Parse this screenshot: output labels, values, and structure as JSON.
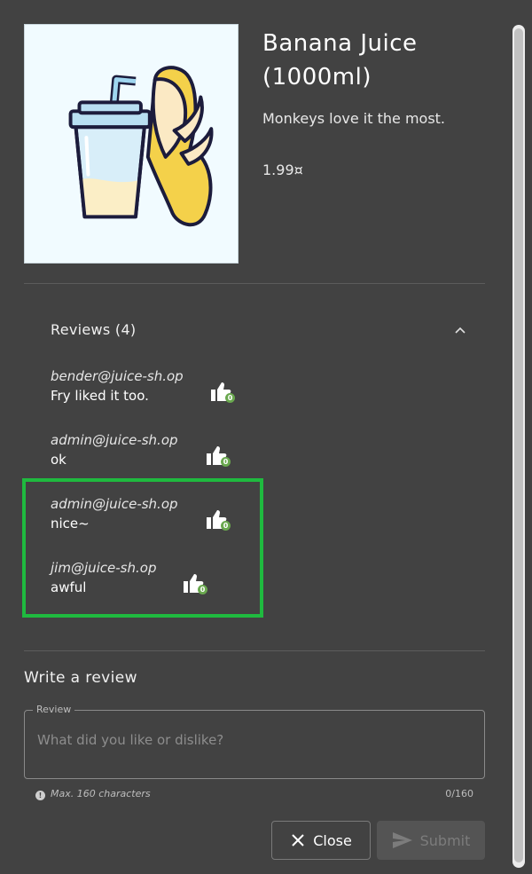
{
  "product": {
    "name": "Banana Juice (1000ml)",
    "description": "Monkeys love it the most.",
    "price": "1.99¤"
  },
  "reviews": {
    "title": "Reviews (4)",
    "items": [
      {
        "author": "bender@juice-sh.op",
        "text": "Fry liked it too.",
        "likes": "0"
      },
      {
        "author": "admin@juice-sh.op",
        "text": "ok",
        "likes": "0"
      },
      {
        "author": "admin@juice-sh.op",
        "text": "nice~",
        "likes": "0"
      },
      {
        "author": "jim@juice-sh.op",
        "text": "awful",
        "likes": "0"
      }
    ]
  },
  "write_review": {
    "title": "Write a review",
    "field_label": "Review",
    "placeholder": "What did you like or dislike?",
    "hint": "Max. 160 characters",
    "counter": "0/160"
  },
  "buttons": {
    "close": "Close",
    "submit": "Submit"
  },
  "colors": {
    "background": "#424242",
    "highlight": "#1fba3f",
    "like_badge": "#6aa84f"
  },
  "icons": {
    "collapse": "chevron-up-icon",
    "like": "thumbs-up-icon",
    "info": "info-circle-icon",
    "close": "close-x-icon",
    "submit": "send-icon"
  }
}
